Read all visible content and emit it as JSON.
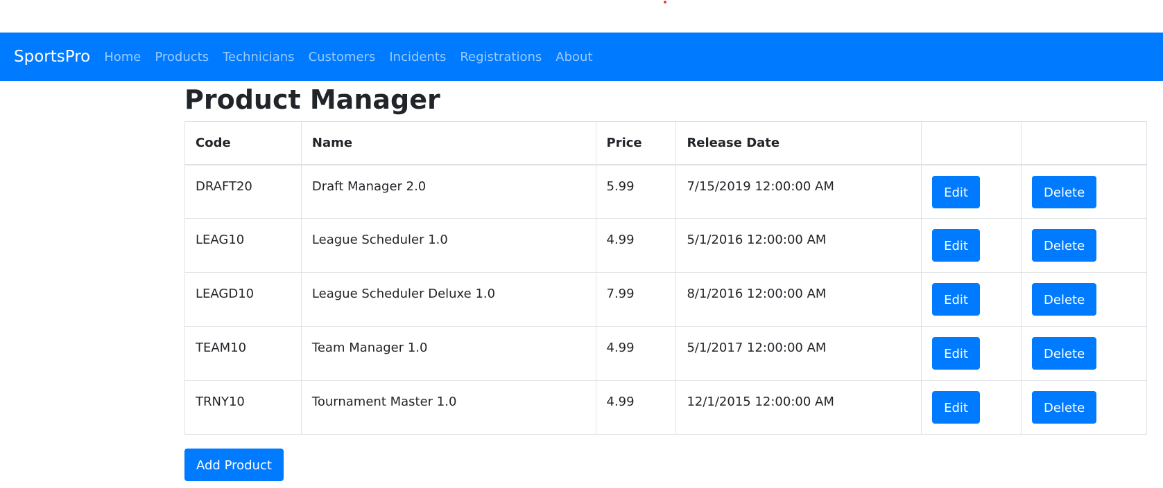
{
  "navbar": {
    "brand": "SportsPro",
    "links": [
      "Home",
      "Products",
      "Technicians",
      "Customers",
      "Incidents",
      "Registrations",
      "About"
    ]
  },
  "page": {
    "title": "Product Manager"
  },
  "table": {
    "headers": [
      "Code",
      "Name",
      "Price",
      "Release Date",
      "",
      ""
    ],
    "edit_label": "Edit",
    "delete_label": "Delete",
    "rows": [
      {
        "code": "DRAFT20",
        "name": "Draft Manager 2.0",
        "price": "5.99",
        "release_date": "7/15/2019 12:00:00 AM"
      },
      {
        "code": "LEAG10",
        "name": "League Scheduler 1.0",
        "price": "4.99",
        "release_date": "5/1/2016 12:00:00 AM"
      },
      {
        "code": "LEAGD10",
        "name": "League Scheduler Deluxe 1.0",
        "price": "7.99",
        "release_date": "8/1/2016 12:00:00 AM"
      },
      {
        "code": "TEAM10",
        "name": "Team Manager 1.0",
        "price": "4.99",
        "release_date": "5/1/2017 12:00:00 AM"
      },
      {
        "code": "TRNY10",
        "name": "Tournament Master 1.0",
        "price": "4.99",
        "release_date": "12/1/2015 12:00:00 AM"
      }
    ]
  },
  "actions": {
    "add_label": "Add Product"
  },
  "colors": {
    "primary": "#007bff",
    "nav_link": "rgba(255,255,255,0.6)"
  }
}
